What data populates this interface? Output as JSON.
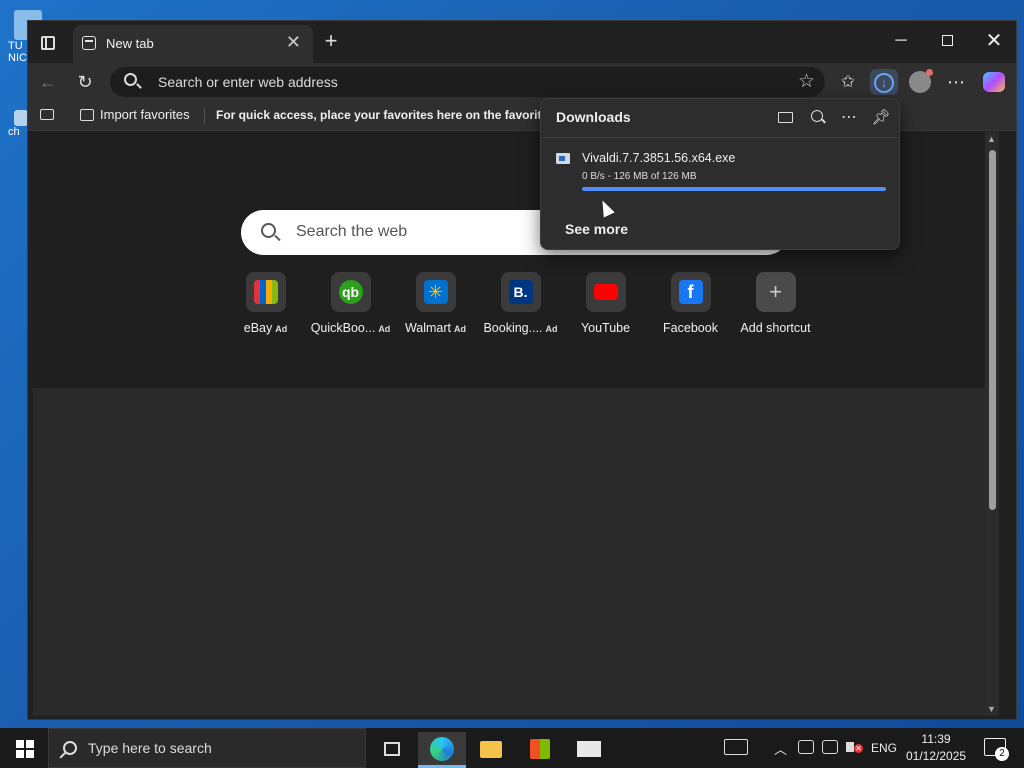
{
  "desktop": {
    "icon1_label": "TU NIC",
    "icon2_label": "ch"
  },
  "browser": {
    "tab_title": "New tab",
    "address_placeholder": "Search or enter web address",
    "favorites_bar": {
      "import_label": "Import favorites",
      "message": "For quick access, place your favorites here on the favorites bar."
    },
    "new_tab_page": {
      "search_placeholder": "Search the web",
      "shortcuts": [
        {
          "name": "eBay",
          "ad": "Ad"
        },
        {
          "name": "QuickBoo...",
          "ad": "Ad"
        },
        {
          "name": "Walmart",
          "ad": "Ad"
        },
        {
          "name": "Booking....",
          "ad": "Ad"
        },
        {
          "name": "YouTube",
          "ad": ""
        },
        {
          "name": "Facebook",
          "ad": ""
        },
        {
          "name": "Add shortcut",
          "ad": ""
        }
      ]
    },
    "downloads": {
      "title": "Downloads",
      "item": {
        "filename": "Vivaldi.7.7.3851.56.x64.exe",
        "status": "0 B/s - 126 MB of 126 MB",
        "progress": 1.0
      },
      "see_more": "See more"
    }
  },
  "taskbar": {
    "search_placeholder": "Type here to search",
    "language": "ENG",
    "time": "11:39",
    "date": "01/12/2025",
    "notification_count": "2"
  },
  "colors": {
    "accent": "#4f8ef7",
    "background": "#202020"
  }
}
